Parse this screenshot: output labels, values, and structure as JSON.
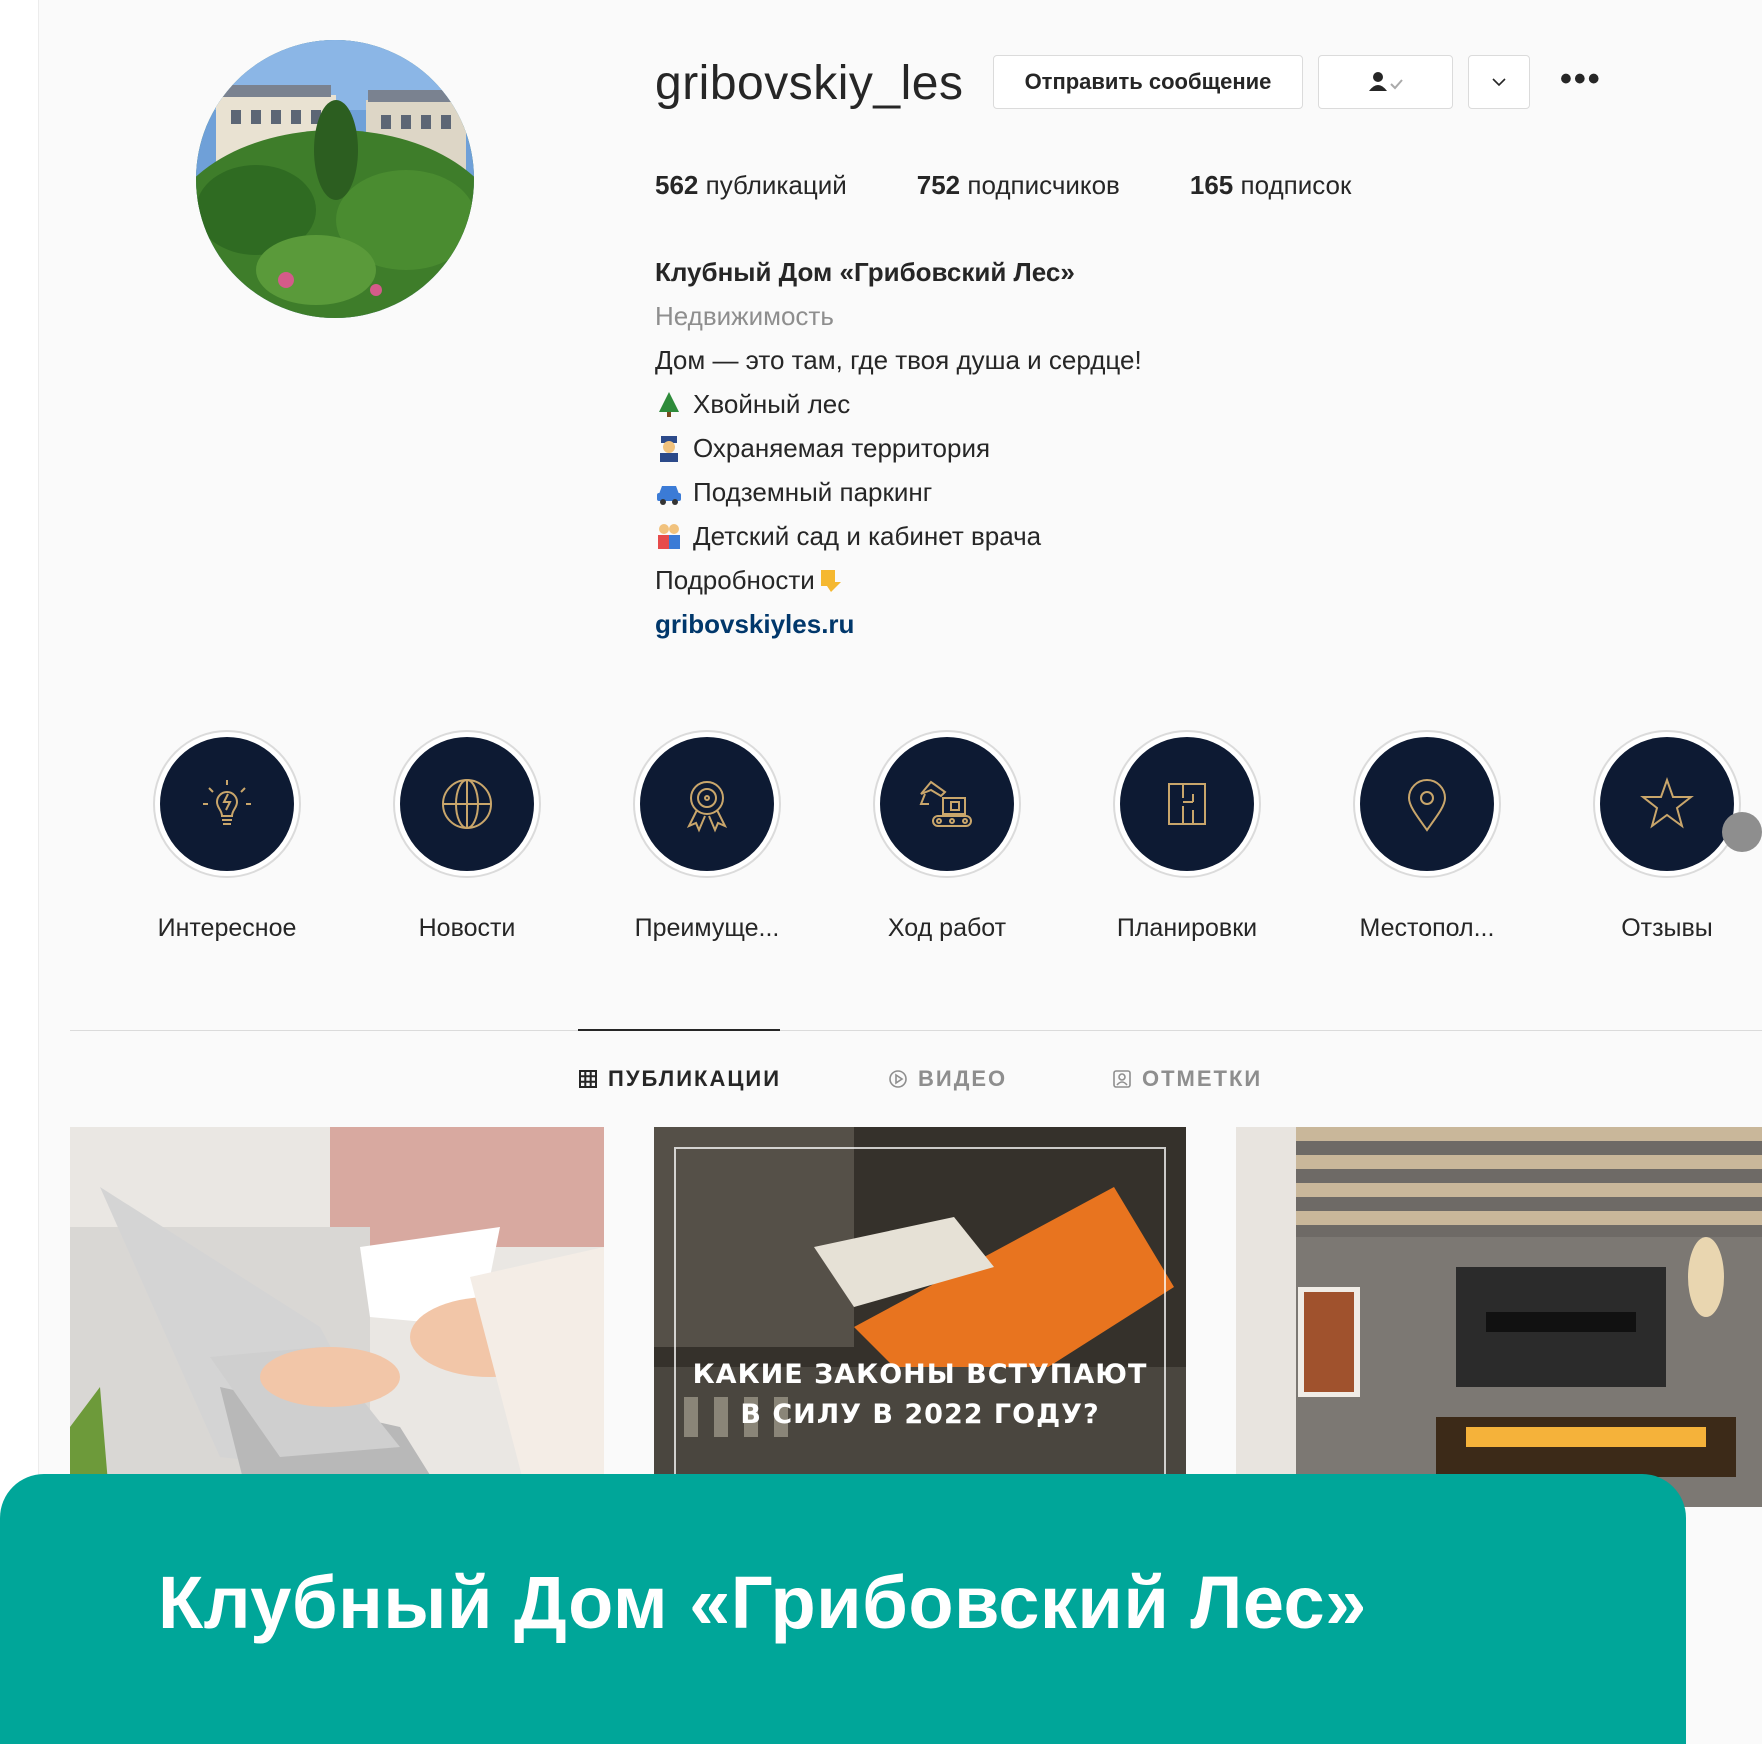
{
  "profile": {
    "username": "gribovskiy_les",
    "message_button": "Отправить сообщение"
  },
  "stats": {
    "posts_count": "562",
    "posts_label": "публикаций",
    "followers_count": "752",
    "followers_label": "подписчиков",
    "following_count": "165",
    "following_label": "подписок"
  },
  "bio": {
    "name": "Клубный Дом «Грибовский Лес»",
    "category": "Недвижимость",
    "tagline": "Дом — это там, где твоя душа и сердце!",
    "lines": [
      {
        "icon": "evergreen-tree-icon",
        "text": "Хвойный лес"
      },
      {
        "icon": "guard-icon",
        "text": "Охраняемая территория"
      },
      {
        "icon": "car-icon",
        "text": "Подземный паркинг"
      },
      {
        "icon": "family-icon",
        "text": "Детский сад и кабинет врача"
      }
    ],
    "details": "Подробности",
    "link": "gribovskiyles.ru"
  },
  "highlights": [
    {
      "label": "Интересное",
      "icon": "lightbulb-icon"
    },
    {
      "label": "Новости",
      "icon": "globe-icon"
    },
    {
      "label": "Преимуще...",
      "icon": "award-icon"
    },
    {
      "label": "Ход работ",
      "icon": "excavator-icon"
    },
    {
      "label": "Планировки",
      "icon": "floorplan-icon"
    },
    {
      "label": "Местопол...",
      "icon": "location-pin-icon"
    },
    {
      "label": "Отзывы",
      "icon": "star-icon"
    }
  ],
  "tabs": {
    "posts": "ПУБЛИКАЦИИ",
    "video": "ВИДЕО",
    "tagged": "ОТМЕТКИ"
  },
  "posts": {
    "post2_caption_line1": "КАКИЕ ЗАКОНЫ ВСТУПАЮТ",
    "post2_caption_line2": "В СИЛУ В 2022 ГОДУ?"
  },
  "banner": {
    "title": "Клубный Дом «Грибовский Лес»"
  },
  "colors": {
    "banner": "#00a699",
    "highlight_bg": "#0d1a33",
    "highlight_icon": "#c9a66b",
    "link": "#00376b"
  }
}
